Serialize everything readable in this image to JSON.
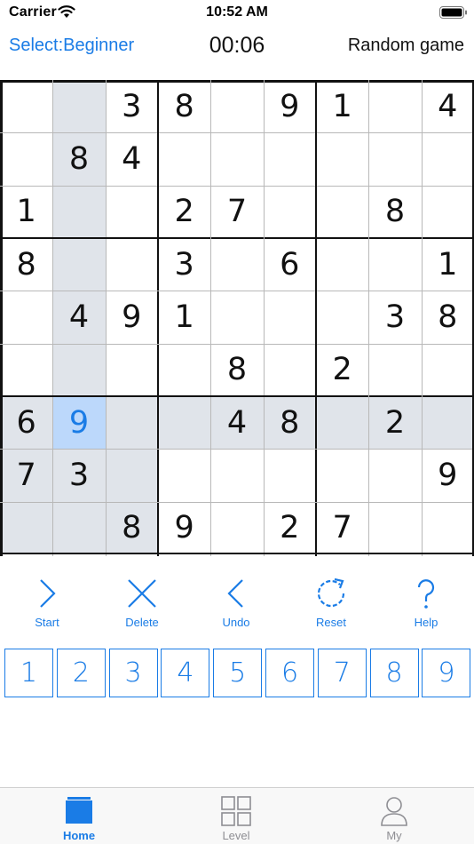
{
  "status_bar": {
    "carrier": "Carrier",
    "time": "10:52 AM"
  },
  "header": {
    "select_label": "Select:Beginner",
    "timer": "00:06",
    "random_game": "Random game"
  },
  "colors": {
    "accent": "#1a7ce6",
    "highlight": "#e0e4ea",
    "selected": "#bcd8fb"
  },
  "board": {
    "rows": [
      [
        "",
        "",
        "3",
        "8",
        "",
        "9",
        "1",
        "",
        "4"
      ],
      [
        "",
        "8",
        "4",
        "",
        "",
        "",
        "",
        "",
        ""
      ],
      [
        "1",
        "",
        "",
        "2",
        "7",
        "",
        "",
        "8",
        ""
      ],
      [
        "8",
        "",
        "",
        "3",
        "",
        "6",
        "",
        "",
        "1"
      ],
      [
        "",
        "4",
        "9",
        "1",
        "",
        "",
        "",
        "3",
        "8"
      ],
      [
        "",
        "",
        "",
        "",
        "8",
        "",
        "2",
        "",
        ""
      ],
      [
        "6",
        "9",
        "",
        "",
        "4",
        "8",
        "",
        "2",
        ""
      ],
      [
        "7",
        "3",
        "",
        "",
        "",
        "",
        "",
        "",
        "9"
      ],
      [
        "",
        "",
        "8",
        "9",
        "",
        "2",
        "7",
        "",
        ""
      ]
    ],
    "selected": {
      "row": 6,
      "col": 1
    }
  },
  "tools": [
    {
      "label": "Start",
      "icon": "chevron-right-icon"
    },
    {
      "label": "Delete",
      "icon": "close-icon"
    },
    {
      "label": "Undo",
      "icon": "chevron-left-icon"
    },
    {
      "label": "Reset",
      "icon": "refresh-icon"
    },
    {
      "label": "Help",
      "icon": "question-icon"
    }
  ],
  "numpad": [
    "1",
    "2",
    "3",
    "4",
    "5",
    "6",
    "7",
    "8",
    "9"
  ],
  "tabs": [
    {
      "label": "Home",
      "icon": "home-icon",
      "active": true
    },
    {
      "label": "Level",
      "icon": "grid-icon",
      "active": false
    },
    {
      "label": "My",
      "icon": "person-icon",
      "active": false
    }
  ]
}
